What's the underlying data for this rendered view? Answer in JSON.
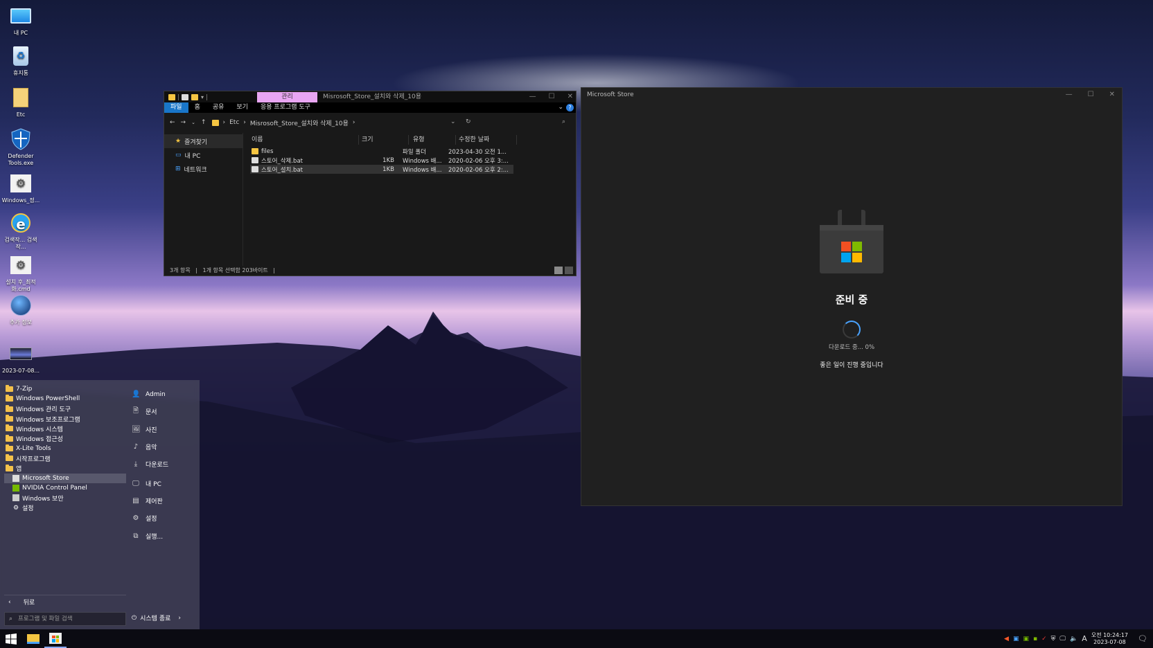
{
  "desktop": {
    "icons": [
      {
        "label": "내 PC",
        "icon": "monitor-icon"
      },
      {
        "label": "휴지통",
        "icon": "recycle-bin-icon"
      },
      {
        "label": "Etc",
        "icon": "folder-icon"
      },
      {
        "label": "Defender Tools.exe",
        "icon": "shield-icon"
      },
      {
        "label": "Windows_정...",
        "icon": "settings-file-icon"
      },
      {
        "label": "검색작... 검색작...",
        "icon": "ie-icon"
      },
      {
        "label": "설치 후_최적화.cmd",
        "icon": "cmd-file-icon"
      },
      {
        "label": "추가 정보",
        "icon": "info-globe-icon"
      },
      {
        "label": "2023-07-08...",
        "icon": "screenshot-icon"
      }
    ]
  },
  "explorer": {
    "context_tab": "관리",
    "title": "Misrosoft_Store_설치와 삭제_10용",
    "ribbon_tabs": [
      "파일",
      "홈",
      "공유",
      "보기",
      "응용 프로그램 도구"
    ],
    "breadcrumb": [
      "Etc",
      "Misrosoft_Store_설치와 삭제_10용"
    ],
    "nav": [
      "즐겨찾기",
      "내 PC",
      "네트워크"
    ],
    "columns": [
      "이름",
      "크기",
      "유형",
      "수정한 날짜"
    ],
    "files": [
      {
        "name": "files",
        "size": "",
        "type": "파일 폴더",
        "date": "2023-04-30 오전 1..."
      },
      {
        "name": "스토어_삭제.bat",
        "size": "1KB",
        "type": "Windows 배...",
        "date": "2020-02-06 오후 3:..."
      },
      {
        "name": "스토어_설치.bat",
        "size": "1KB",
        "type": "Windows 배...",
        "date": "2020-02-06 오후 2:..."
      }
    ],
    "status_count": "3개 항목",
    "status_selected": "1개 항목 선택함 203바이트"
  },
  "store": {
    "title": "Microsoft Store",
    "status": "준비 중",
    "download": "다운로드 중... 0%",
    "message": "좋은 일이 진행 중입니다",
    "colors": {
      "red": "#f25022",
      "green": "#7fba00",
      "blue": "#00a4ef",
      "yellow": "#ffb900"
    }
  },
  "start_menu": {
    "programs": [
      {
        "label": "7-Zip",
        "kind": "folder"
      },
      {
        "label": "Windows PowerShell",
        "kind": "folder"
      },
      {
        "label": "Windows 관리 도구",
        "kind": "folder"
      },
      {
        "label": "Windows 보조프로그램",
        "kind": "folder"
      },
      {
        "label": "Windows 시스템",
        "kind": "folder"
      },
      {
        "label": "Windows 접근성",
        "kind": "folder"
      },
      {
        "label": "X-Lite Tools",
        "kind": "folder"
      },
      {
        "label": "시작프로그램",
        "kind": "folder"
      },
      {
        "label": "앱",
        "kind": "folder"
      },
      {
        "label": "Microsoft Store",
        "kind": "app"
      },
      {
        "label": "NVIDIA Control Panel",
        "kind": "app"
      },
      {
        "label": "Windows 보안",
        "kind": "app"
      },
      {
        "label": "설정",
        "kind": "app"
      }
    ],
    "places": [
      {
        "label": "Admin",
        "icon": "user-icon"
      },
      {
        "label": "문서",
        "icon": "document-icon"
      },
      {
        "label": "사진",
        "icon": "picture-icon"
      },
      {
        "label": "음악",
        "icon": "music-icon"
      },
      {
        "label": "다운로드",
        "icon": "download-icon"
      },
      {
        "label": "내 PC",
        "icon": "pc-icon"
      },
      {
        "label": "제어판",
        "icon": "control-panel-icon"
      },
      {
        "label": "설정",
        "icon": "gear-icon"
      },
      {
        "label": "실행...",
        "icon": "run-icon"
      }
    ],
    "back": "뒤로",
    "search_placeholder": "프로그램 및 파일 검색",
    "shutdown": "시스템 종료"
  },
  "taskbar": {
    "time": "오전 10:24:17",
    "date": "2023-07-08",
    "ime": "A"
  }
}
